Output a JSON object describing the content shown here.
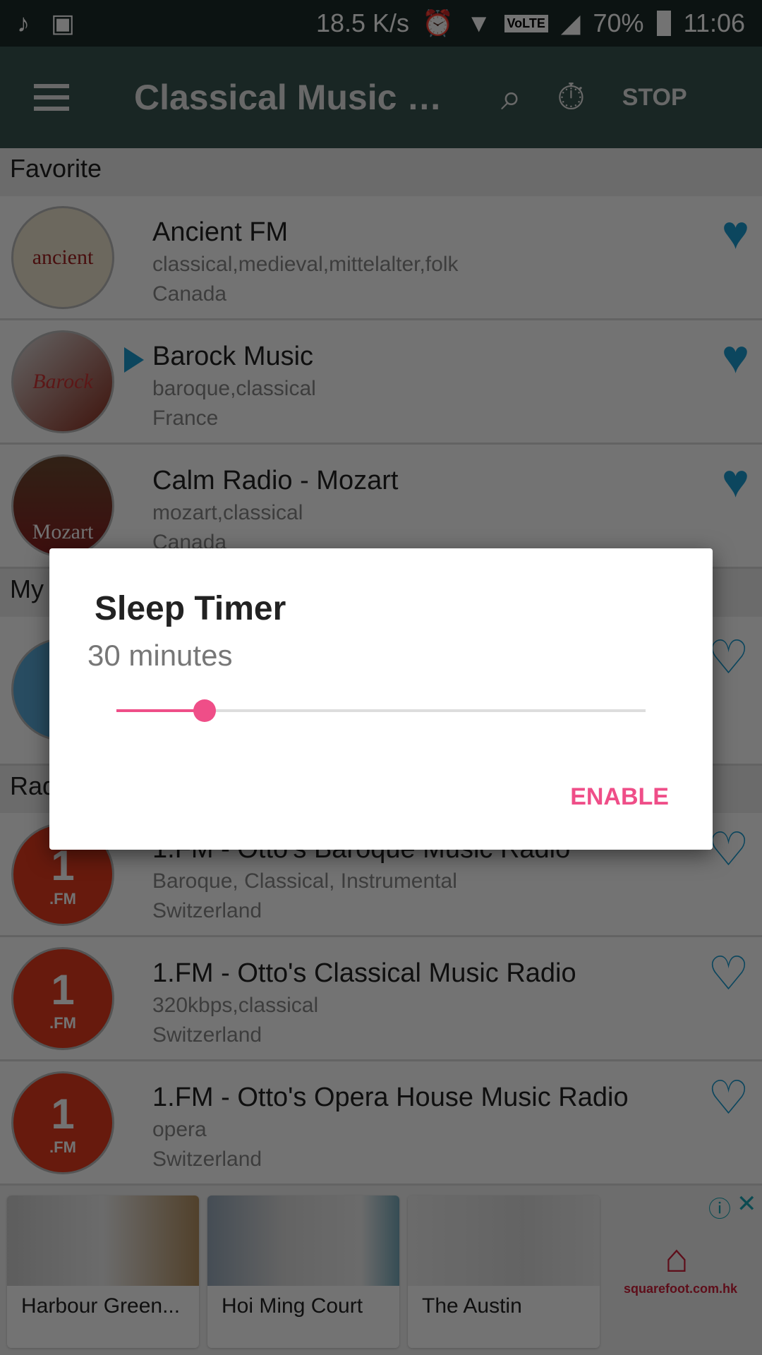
{
  "status_bar": {
    "net_speed": "18.5 K/s",
    "battery": "70%",
    "time": "11:06",
    "volte": "VoLTE",
    "icons": [
      "music-note-icon",
      "image-icon",
      "alarm-icon",
      "wifi-icon",
      "signal-icon",
      "battery-icon"
    ]
  },
  "toolbar": {
    "title": "Classical Music Radio",
    "stop_label": "STOP",
    "icons": [
      "menu-icon",
      "search-icon",
      "timer-icon"
    ]
  },
  "sections": {
    "favorite": "Favorite",
    "my": "My",
    "radio": "Radio"
  },
  "favorites": [
    {
      "name": "Ancient FM",
      "tags": "classical,medieval,mittelalter,folk",
      "country": "Canada",
      "favorited": true,
      "logo": "ancient fm"
    },
    {
      "name": "Barock Music",
      "tags": "baroque,classical",
      "country": "France",
      "favorited": true,
      "playing": true,
      "logo": "Barock Music"
    },
    {
      "name": "Calm Radio - Mozart",
      "tags": "mozart,classical",
      "country": "Canada",
      "favorited": true,
      "logo": "Mozart"
    }
  ],
  "radios": [
    {
      "name": "1.FM - Otto's Baroque Music Radio",
      "tags": "Baroque, Classical, Instrumental",
      "country": "Switzerland",
      "favorited": false,
      "logo": ".FM"
    },
    {
      "name": "1.FM - Otto's Classical Music Radio",
      "tags": "320kbps,classical",
      "country": "Switzerland",
      "favorited": false,
      "logo": ".FM"
    },
    {
      "name": "1.FM - Otto's Opera House Music Radio",
      "tags": "opera",
      "country": "Switzerland",
      "favorited": false,
      "logo": ".FM"
    }
  ],
  "ad": {
    "cards": [
      "Harbour Green...",
      "Hoi Ming Court",
      "The Austin"
    ],
    "brand": "squarefoot.com.hk"
  },
  "dialog": {
    "title": "Sleep Timer",
    "value_label": "30 minutes",
    "slider_fraction": 0.167,
    "enable_label": "ENABLE"
  },
  "colors": {
    "accent": "#ef4e88",
    "heart": "#1a9bd0",
    "toolbar": "#37544f"
  }
}
